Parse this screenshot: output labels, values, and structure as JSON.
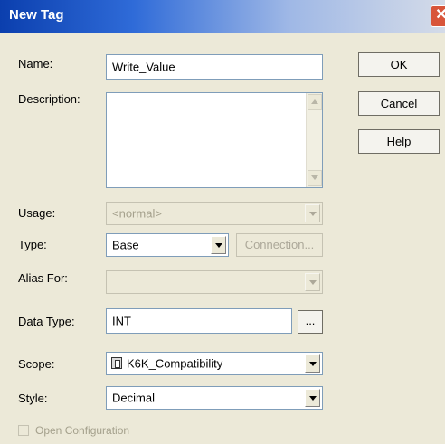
{
  "window": {
    "title": "New Tag",
    "close_symbol": "✕"
  },
  "labels": {
    "name": "Name:",
    "description": "Description:",
    "usage": "Usage:",
    "type": "Type:",
    "alias_for": "Alias For:",
    "data_type": "Data Type:",
    "scope": "Scope:",
    "style": "Style:"
  },
  "fields": {
    "name_value": "Write_Value",
    "description_value": "",
    "usage_value": "<normal>",
    "type_value": "Base",
    "alias_for_value": "",
    "data_type_value": "INT",
    "scope_value": "K6K_Compatibility",
    "style_value": "Decimal"
  },
  "buttons": {
    "ok": "OK",
    "cancel": "Cancel",
    "help": "Help",
    "connection": "Connection...",
    "browse": "..."
  },
  "checkbox": {
    "label": "Open Configuration",
    "checked": false
  },
  "icons": {
    "scope": "controller-icon"
  }
}
